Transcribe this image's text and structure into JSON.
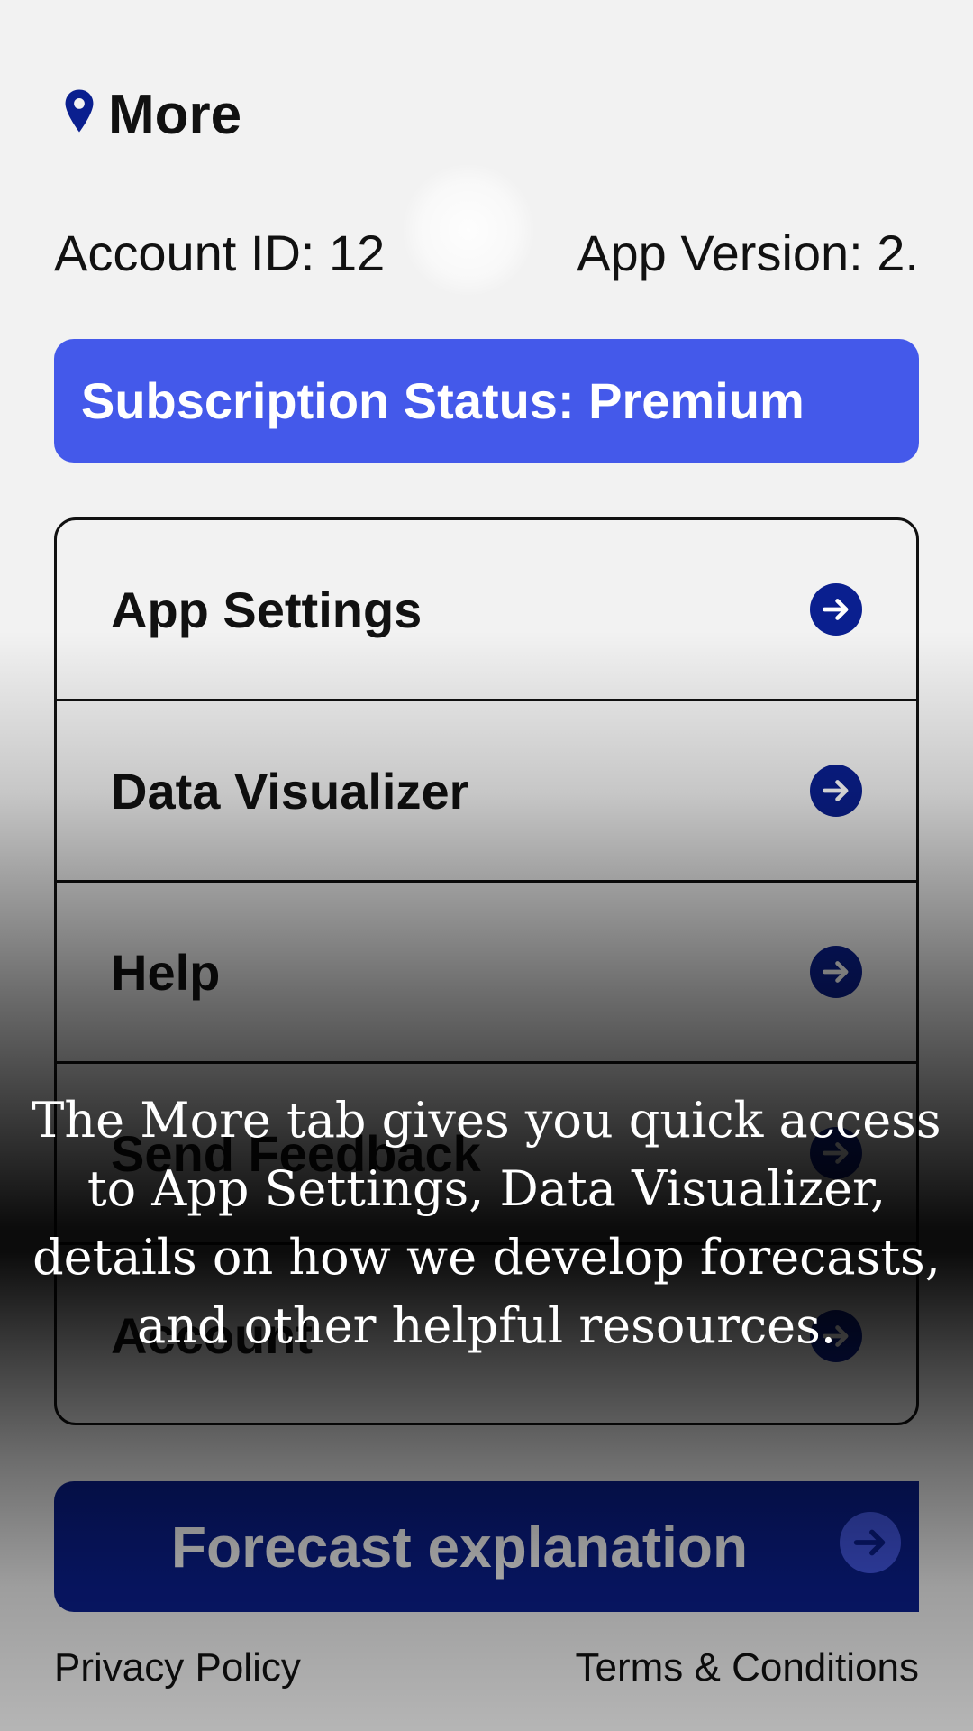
{
  "header": {
    "title": "More",
    "icon": "location-pin-icon",
    "accent": "#0a1f8f"
  },
  "info": {
    "account_id": "Account ID: 12",
    "app_version": "App Version: 2."
  },
  "subscription": {
    "label": "Subscription Status: Premium",
    "color": "#4459ea"
  },
  "menu": {
    "items": [
      {
        "label": "App Settings",
        "icon": "arrow-right-circle-icon"
      },
      {
        "label": "Data Visualizer",
        "icon": "arrow-right-circle-icon"
      },
      {
        "label": "Help",
        "icon": "arrow-right-circle-icon"
      },
      {
        "label": "Send Feedback",
        "icon": "arrow-right-circle-icon"
      },
      {
        "label": "Account",
        "icon": "arrow-right-circle-icon"
      }
    ]
  },
  "forecast": {
    "label": "Forecast explanation",
    "icon": "arrow-right-circle-icon"
  },
  "footer": {
    "privacy": "Privacy Policy",
    "terms": "Terms & Conditions"
  },
  "overlay": {
    "message": "The More tab gives you quick access to App Settings, Data Visualizer, details on how we  develop forecasts, and other helpful resources."
  }
}
